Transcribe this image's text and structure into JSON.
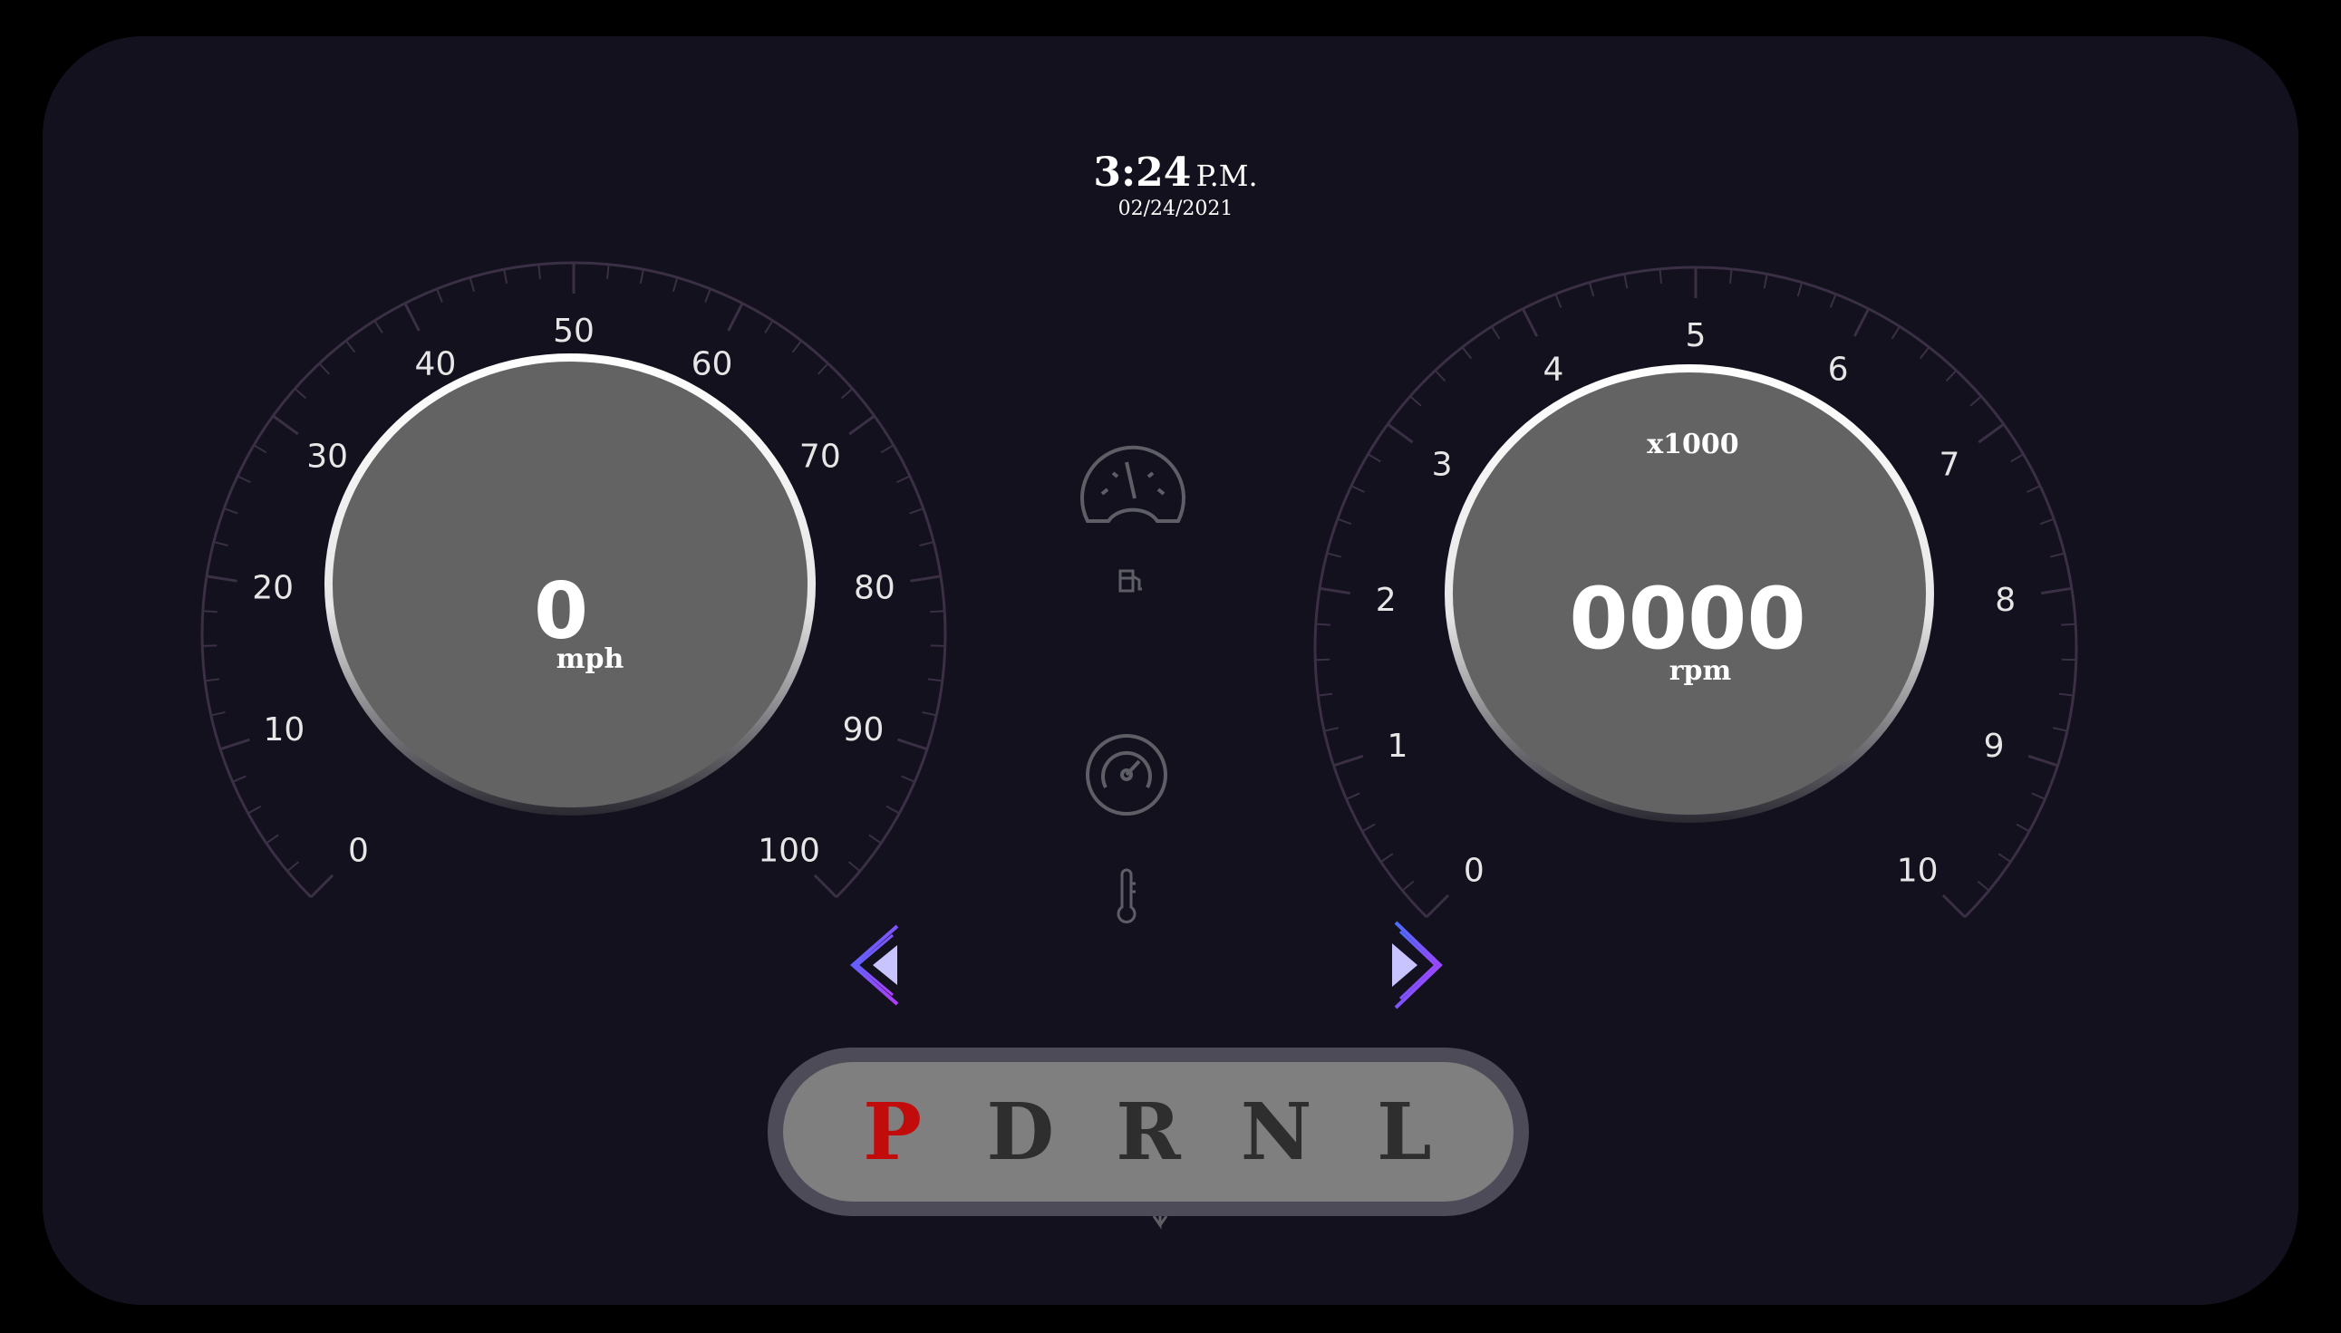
{
  "clock": {
    "time": "3:24",
    "ampm": "P.M.",
    "date": "02/24/2021"
  },
  "speedometer": {
    "value": "0",
    "unit": "mph",
    "ticks": [
      "0",
      "10",
      "20",
      "30",
      "40",
      "50",
      "60",
      "70",
      "80",
      "90",
      "100"
    ],
    "min": 0,
    "max": 100
  },
  "tachometer": {
    "value": "0000",
    "multiplier": "x1000",
    "unit": "rpm",
    "ticks": [
      "0",
      "1",
      "2",
      "3",
      "4",
      "5",
      "6",
      "7",
      "8",
      "9",
      "10"
    ],
    "min": 0,
    "max": 10
  },
  "indicators": {
    "fuel_gauge_icon": "fuel-gauge-icon",
    "fuel_pump_icon": "fuel-pump-icon",
    "engine_temp_icon": "engine-temp-gauge-icon",
    "thermometer_icon": "thermometer-icon",
    "left_turn_icon": "left-turn-signal-icon",
    "right_turn_icon": "right-turn-signal-icon",
    "transmission_icon": "transmission-shift-icon"
  },
  "gear_selector": {
    "gears": [
      "P",
      "D",
      "R",
      "N",
      "L"
    ],
    "active": "P"
  },
  "colors": {
    "background": "#12111d",
    "gauge_face": "#636363",
    "gauge_ring": "#ffffff",
    "active_gear": "#c20c0c",
    "turn_signal": "#7b4dff"
  }
}
